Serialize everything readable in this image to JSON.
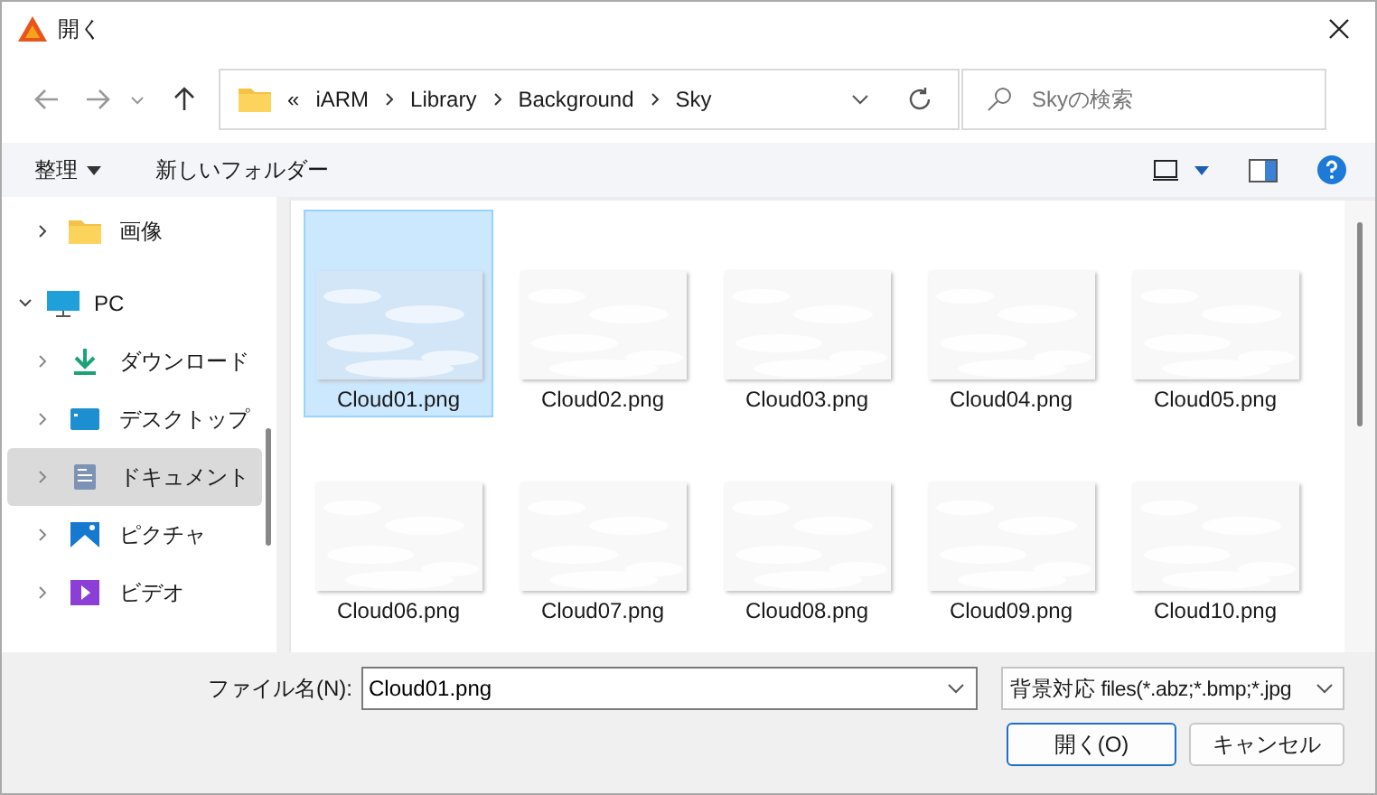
{
  "window": {
    "title": "開く"
  },
  "nav": {
    "path_prefix": "«",
    "path": [
      "iARM",
      "Library",
      "Background",
      "Sky"
    ],
    "search": {
      "placeholder": "Skyの検索"
    }
  },
  "toolbar": {
    "organize": "整理",
    "new_folder": "新しいフォルダー"
  },
  "sidebar": {
    "items": [
      {
        "label": "画像",
        "kind": "folder",
        "expanded": false,
        "selected": false
      },
      {
        "label": "PC",
        "kind": "pc",
        "expanded": true,
        "selected": false,
        "children": [
          {
            "label": "ダウンロード",
            "kind": "download",
            "expanded": false,
            "selected": false
          },
          {
            "label": "デスクトップ",
            "kind": "desktop",
            "expanded": false,
            "selected": false
          },
          {
            "label": "ドキュメント",
            "kind": "documents",
            "expanded": false,
            "selected": true
          },
          {
            "label": "ピクチャ",
            "kind": "pictures",
            "expanded": false,
            "selected": false
          },
          {
            "label": "ビデオ",
            "kind": "videos",
            "expanded": false,
            "selected": false
          }
        ]
      }
    ]
  },
  "files": [
    {
      "name": "Cloud01.png",
      "selected": true
    },
    {
      "name": "Cloud02.png",
      "selected": false
    },
    {
      "name": "Cloud03.png",
      "selected": false
    },
    {
      "name": "Cloud04.png",
      "selected": false
    },
    {
      "name": "Cloud05.png",
      "selected": false
    },
    {
      "name": "Cloud06.png",
      "selected": false
    },
    {
      "name": "Cloud07.png",
      "selected": false
    },
    {
      "name": "Cloud08.png",
      "selected": false
    },
    {
      "name": "Cloud09.png",
      "selected": false
    },
    {
      "name": "Cloud10.png",
      "selected": false
    }
  ],
  "footer": {
    "filename_label": "ファイル名(N):",
    "filename": "Cloud01.png",
    "filter": "背景対応 files(*.abz;*.bmp;*.jpg",
    "buttons": [
      {
        "label": "開く(O)",
        "kind": "primary"
      },
      {
        "label": "キャンセル",
        "kind": "normal"
      }
    ]
  }
}
